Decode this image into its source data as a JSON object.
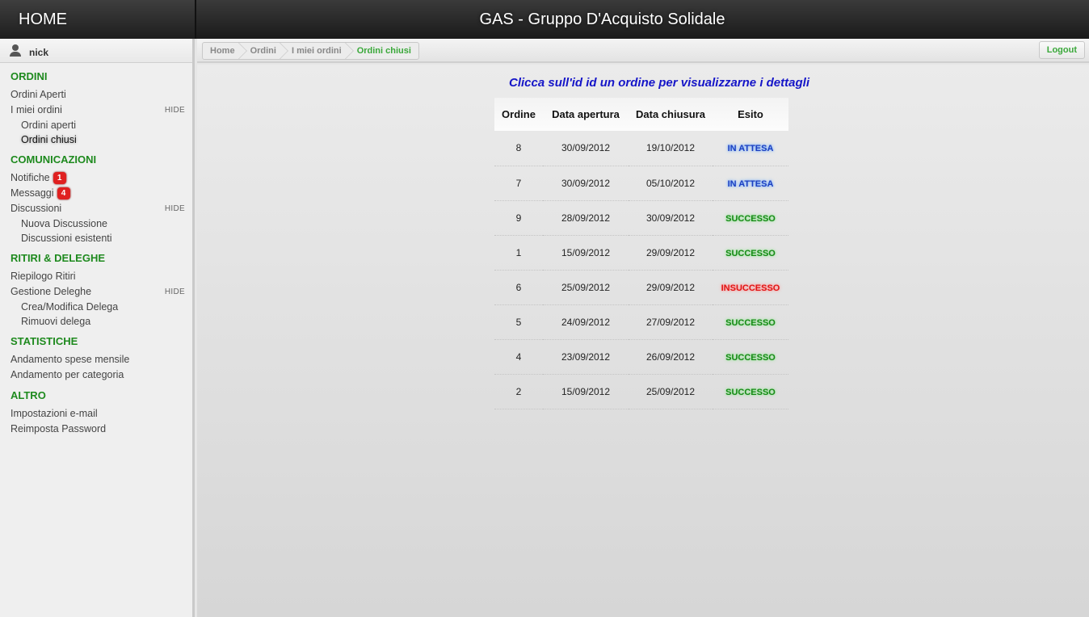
{
  "header": {
    "home_label": "HOME",
    "title": "GAS - Gruppo D'Acquisto Solidale"
  },
  "user": {
    "name": "nick"
  },
  "sidebar": {
    "hide_label": "HIDE",
    "ordini": {
      "title": "ORDINI",
      "aperti": "Ordini Aperti",
      "miei": "I miei ordini",
      "miei_aperti": "Ordini aperti",
      "miei_chiusi": "Ordini chiusi"
    },
    "comunicazioni": {
      "title": "COMUNICAZIONI",
      "notifiche": "Notifiche",
      "notifiche_count": "1",
      "messaggi": "Messaggi",
      "messaggi_count": "4",
      "discussioni": "Discussioni",
      "nuova": "Nuova Discussione",
      "esistenti": "Discussioni esistenti"
    },
    "ritiri": {
      "title": "RITIRI & DELEGHE",
      "riepilogo": "Riepilogo Ritiri",
      "gestione": "Gestione Deleghe",
      "crea": "Crea/Modifica Delega",
      "rimuovi": "Rimuovi delega"
    },
    "statistiche": {
      "title": "STATISTICHE",
      "mensile": "Andamento spese mensile",
      "categoria": "Andamento per categoria"
    },
    "altro": {
      "title": "ALTRO",
      "email": "Impostazioni e-mail",
      "password": "Reimposta Password"
    }
  },
  "breadcrumb": [
    "Home",
    "Ordini",
    "I miei ordini",
    "Ordini chiusi"
  ],
  "logout_label": "Logout",
  "main": {
    "instruction": "Clicca sull'id id un ordine per visualizzarne i dettagli",
    "columns": [
      "Ordine",
      "Data apertura",
      "Data chiusura",
      "Esito"
    ],
    "rows": [
      {
        "id": "8",
        "apertura": "30/09/2012",
        "chiusura": "19/10/2012",
        "esito": "IN ATTESA",
        "kind": "wait"
      },
      {
        "id": "7",
        "apertura": "30/09/2012",
        "chiusura": "05/10/2012",
        "esito": "IN ATTESA",
        "kind": "wait"
      },
      {
        "id": "9",
        "apertura": "28/09/2012",
        "chiusura": "30/09/2012",
        "esito": "SUCCESSO",
        "kind": "ok"
      },
      {
        "id": "1",
        "apertura": "15/09/2012",
        "chiusura": "29/09/2012",
        "esito": "SUCCESSO",
        "kind": "ok"
      },
      {
        "id": "6",
        "apertura": "25/09/2012",
        "chiusura": "29/09/2012",
        "esito": "INSUCCESSO",
        "kind": "ko"
      },
      {
        "id": "5",
        "apertura": "24/09/2012",
        "chiusura": "27/09/2012",
        "esito": "SUCCESSO",
        "kind": "ok"
      },
      {
        "id": "4",
        "apertura": "23/09/2012",
        "chiusura": "26/09/2012",
        "esito": "SUCCESSO",
        "kind": "ok"
      },
      {
        "id": "2",
        "apertura": "15/09/2012",
        "chiusura": "25/09/2012",
        "esito": "SUCCESSO",
        "kind": "ok"
      }
    ]
  }
}
